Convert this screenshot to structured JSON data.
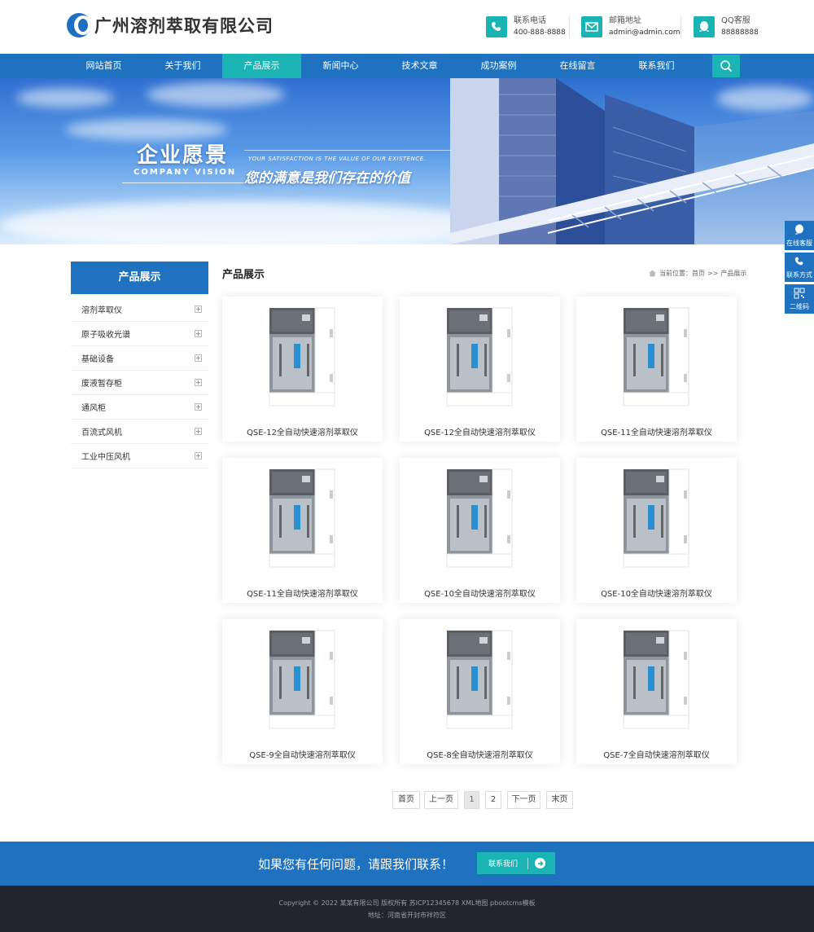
{
  "header": {
    "company_name": "广州溶剂萃取有限公司",
    "contacts": [
      {
        "label": "联系电话",
        "value": "400-888-8888",
        "icon": "phone-icon"
      },
      {
        "label": "邮箱地址",
        "value": "admin@admin.com",
        "icon": "mail-icon"
      },
      {
        "label": "QQ客服",
        "value": "88888888",
        "icon": "qq-icon"
      }
    ]
  },
  "nav": {
    "items": [
      "网站首页",
      "关于我们",
      "产品展示",
      "新闻中心",
      "技术文章",
      "成功案例",
      "在线留言",
      "联系我们"
    ],
    "active_index": 2
  },
  "banner": {
    "title": "企业愿景",
    "title_en": "COMPANY VISION",
    "subtitle_en": "YOUR SATISFACTION IS THE VALUE OF OUR EXISTENCE.",
    "subtitle": "您的满意是我们存在的价值"
  },
  "side_float": [
    {
      "label": "在线客服",
      "icon": "chat-icon"
    },
    {
      "label": "联系方式",
      "icon": "phone-icon"
    },
    {
      "label": "二维码",
      "icon": "qrcode-icon"
    }
  ],
  "sidebar": {
    "title": "产品展示",
    "items": [
      "溶剂萃取仪",
      "原子吸收光谱",
      "基础设备",
      "废液暂存柜",
      "通风柜",
      "百流式风机",
      "工业中压风机"
    ]
  },
  "main": {
    "title": "产品展示",
    "breadcrumb": {
      "prefix": "当前位置：",
      "home": "首页",
      "sep": ">>",
      "current": "产品展示"
    }
  },
  "products": [
    "QSE-12全自动快速溶剂萃取仪",
    "QSE-12全自动快速溶剂萃取仪",
    "QSE-11全自动快速溶剂萃取仪",
    "QSE-11全自动快速溶剂萃取仪",
    "QSE-10全自动快速溶剂萃取仪",
    "QSE-10全自动快速溶剂萃取仪",
    "QSE-9全自动快速溶剂萃取仪",
    "QSE-8全自动快速溶剂萃取仪",
    "QSE-7全自动快速溶剂萃取仪"
  ],
  "pagination": {
    "first": "首页",
    "prev": "上一页",
    "pages": [
      "1",
      "2"
    ],
    "current": "1",
    "next": "下一页",
    "last": "末页"
  },
  "cta": {
    "text": "如果您有任何问题，请跟我们联系！",
    "button": "联系我们"
  },
  "footer": {
    "copyright": "Copyright © 2022 某某有限公司 版权所有 苏ICP12345678  XML地图  pbootcms模板",
    "address": "地址：河南省开封市祥符区"
  },
  "colors": {
    "primary": "#1e72c0",
    "accent": "#19b4b3",
    "footer_bg": "#22252c"
  }
}
